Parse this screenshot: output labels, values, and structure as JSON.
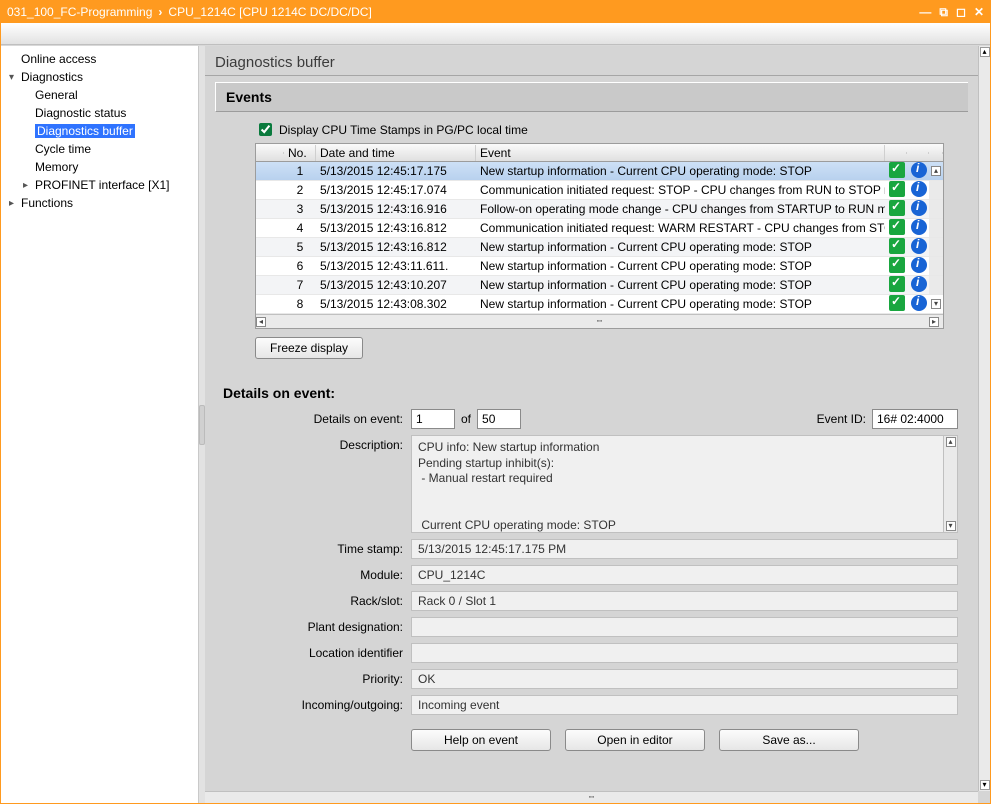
{
  "titlebar": {
    "project": "031_100_FC-Programming",
    "device": "CPU_1214C [CPU 1214C DC/DC/DC]"
  },
  "sidebar": {
    "items": [
      {
        "label": "Online access",
        "expandable": false
      },
      {
        "label": "Diagnostics",
        "expandable": true,
        "expanded": true
      },
      {
        "label": "General"
      },
      {
        "label": "Diagnostic status"
      },
      {
        "label": "Diagnostics buffer",
        "selected": true
      },
      {
        "label": "Cycle time"
      },
      {
        "label": "Memory"
      },
      {
        "label": "PROFINET interface [X1]",
        "collapsed": true
      },
      {
        "label": "Functions",
        "expandable": true,
        "expanded": false
      }
    ]
  },
  "main": {
    "title": "Diagnostics buffer",
    "events": {
      "heading": "Events",
      "checkbox_label": "Display CPU Time Stamps in PG/PC local time",
      "checkbox_checked": true,
      "columns": {
        "no": "No.",
        "datetime": "Date and time",
        "event": "Event"
      },
      "rows": [
        {
          "no": "1",
          "dt": "5/13/2015 12:45:17.175",
          "ev": "New startup information  - Current CPU operating mode: STOP"
        },
        {
          "no": "2",
          "dt": "5/13/2015 12:45:17.074",
          "ev": "Communication initiated request: STOP  - CPU changes from RUN to STOP mode"
        },
        {
          "no": "3",
          "dt": "5/13/2015 12:43:16.916",
          "ev": "Follow-on operating mode change  - CPU changes from STARTUP to RUN mode"
        },
        {
          "no": "4",
          "dt": "5/13/2015 12:43:16.812",
          "ev": "Communication initiated request: WARM RESTART  - CPU changes from STOP t"
        },
        {
          "no": "5",
          "dt": "5/13/2015 12:43:16.812",
          "ev": "New startup information  - Current CPU operating mode: STOP"
        },
        {
          "no": "6",
          "dt": "5/13/2015 12:43:11.611.",
          "ev": "New startup information  - Current CPU operating mode: STOP"
        },
        {
          "no": "7",
          "dt": "5/13/2015 12:43:10.207",
          "ev": "New startup information  - Current CPU operating mode: STOP"
        },
        {
          "no": "8",
          "dt": "5/13/2015 12:43:08.302",
          "ev": "New startup information  - Current CPU operating mode: STOP"
        }
      ],
      "freeze_label": "Freeze display"
    },
    "details": {
      "heading": "Details on event:",
      "labels": {
        "details_on_event": "Details on event:",
        "of": "of",
        "event_id": "Event ID:",
        "description": "Description:",
        "timestamp": "Time stamp:",
        "module": "Module:",
        "rackslot": "Rack/slot:",
        "plant": "Plant designation:",
        "location": "Location identifier",
        "priority": "Priority:",
        "inout": "Incoming/outgoing:"
      },
      "values": {
        "index": "1",
        "total": "50",
        "event_id": "16# 02:4000",
        "description": "CPU info: New startup information\nPending startup inhibit(s):\n - Manual restart required\n\n\n Current CPU operating mode: STOP",
        "timestamp": "5/13/2015 12:45:17.175 PM",
        "module": "CPU_1214C",
        "rackslot": "Rack 0 / Slot 1",
        "plant": "",
        "location": "",
        "priority": "OK",
        "inout": "Incoming event"
      },
      "buttons": {
        "help": "Help on event",
        "open": "Open in editor",
        "save": "Save as..."
      }
    }
  }
}
